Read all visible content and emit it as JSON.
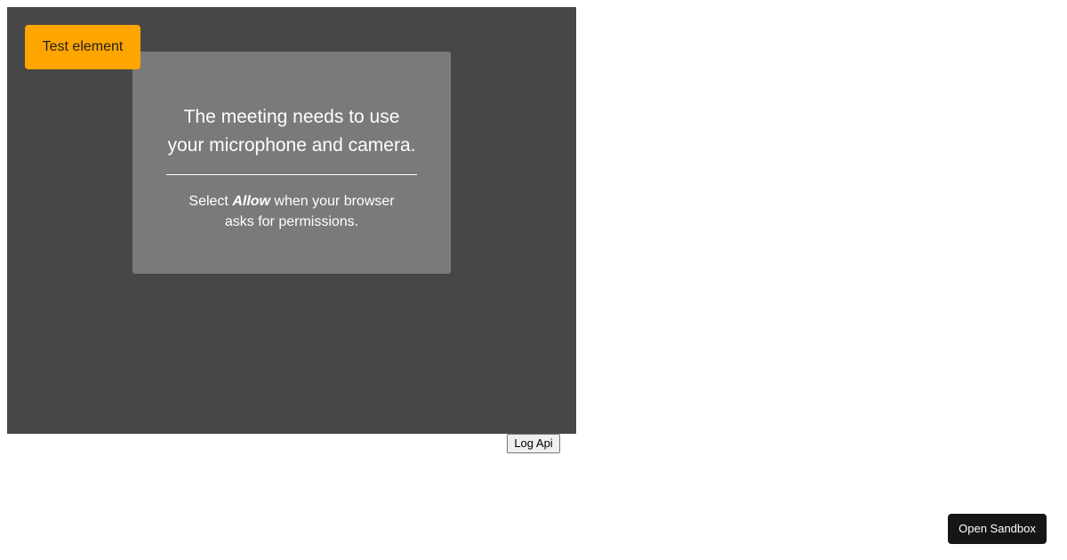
{
  "test_element": {
    "label": "Test element",
    "color": "#ffa500"
  },
  "permission_dialog": {
    "title": "The meeting needs to use your microphone and camera.",
    "body_prefix": "Select ",
    "body_emphasis": "Allow",
    "body_suffix": " when your browser asks for permissions."
  },
  "buttons": {
    "log_api": "Log Api",
    "open_sandbox": "Open Sandbox"
  },
  "colors": {
    "meeting_background": "#474747",
    "dialog_background": "#7a7a7a",
    "sandbox_button": "#151515"
  }
}
